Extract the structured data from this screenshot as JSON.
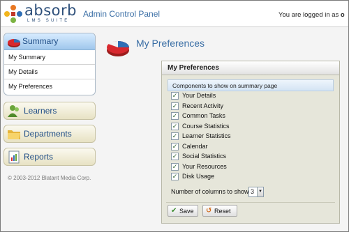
{
  "header": {
    "logo_word": "absorb",
    "logo_sub": "LMS SUITE",
    "app_title": "Admin Control Panel",
    "login_prefix": "You are logged in as",
    "login_user": "o"
  },
  "sidebar": {
    "summary": {
      "label": "Summary",
      "items": [
        {
          "label": "My Summary"
        },
        {
          "label": "My Details"
        },
        {
          "label": "My Preferences"
        }
      ]
    },
    "nav": [
      {
        "label": "Learners",
        "icon": "learners-icon"
      },
      {
        "label": "Departments",
        "icon": "folder-icon"
      },
      {
        "label": "Reports",
        "icon": "report-icon"
      }
    ],
    "copyright": "© 2003-2012 Blatant Media Corp."
  },
  "main": {
    "page_title": "My Preferences",
    "panel": {
      "title": "My Preferences",
      "section_label": "Components to show on summary page",
      "components": [
        {
          "label": "Your Details",
          "checked": true
        },
        {
          "label": "Recent Activity",
          "checked": true
        },
        {
          "label": "Common Tasks",
          "checked": true
        },
        {
          "label": "Course Statistics",
          "checked": true
        },
        {
          "label": "Learner Statistics",
          "checked": true
        },
        {
          "label": "Calendar",
          "checked": true
        },
        {
          "label": "Social Statistics",
          "checked": true
        },
        {
          "label": "Your Resources",
          "checked": true
        },
        {
          "label": "Disk Usage",
          "checked": true
        }
      ],
      "columns_label": "Number of columns to show:",
      "columns_value": "3",
      "save_label": "Save",
      "reset_label": "Reset"
    }
  },
  "colors": {
    "accent_blue": "#3a6ea5",
    "nav_text": "#1f4d86",
    "panel_bg": "#e6e6da"
  }
}
